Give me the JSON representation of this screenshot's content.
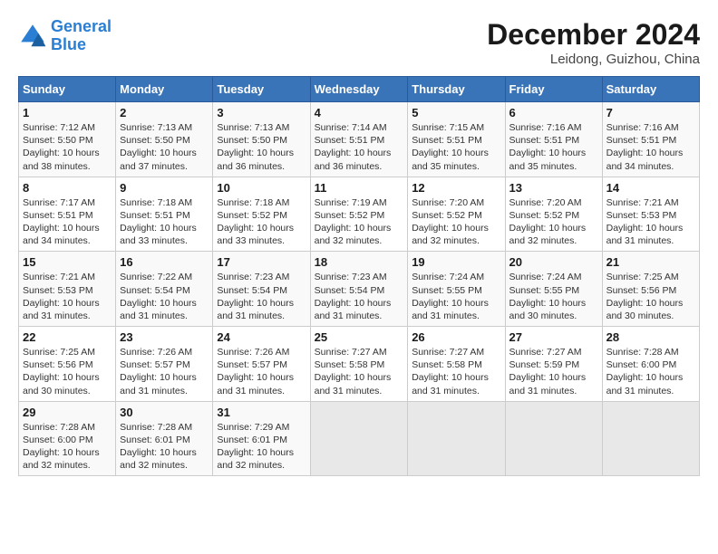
{
  "header": {
    "logo_line1": "General",
    "logo_line2": "Blue",
    "month_year": "December 2024",
    "location": "Leidong, Guizhou, China"
  },
  "weekdays": [
    "Sunday",
    "Monday",
    "Tuesday",
    "Wednesday",
    "Thursday",
    "Friday",
    "Saturday"
  ],
  "weeks": [
    [
      {
        "day": "1",
        "info": "Sunrise: 7:12 AM\nSunset: 5:50 PM\nDaylight: 10 hours\nand 38 minutes."
      },
      {
        "day": "2",
        "info": "Sunrise: 7:13 AM\nSunset: 5:50 PM\nDaylight: 10 hours\nand 37 minutes."
      },
      {
        "day": "3",
        "info": "Sunrise: 7:13 AM\nSunset: 5:50 PM\nDaylight: 10 hours\nand 36 minutes."
      },
      {
        "day": "4",
        "info": "Sunrise: 7:14 AM\nSunset: 5:51 PM\nDaylight: 10 hours\nand 36 minutes."
      },
      {
        "day": "5",
        "info": "Sunrise: 7:15 AM\nSunset: 5:51 PM\nDaylight: 10 hours\nand 35 minutes."
      },
      {
        "day": "6",
        "info": "Sunrise: 7:16 AM\nSunset: 5:51 PM\nDaylight: 10 hours\nand 35 minutes."
      },
      {
        "day": "7",
        "info": "Sunrise: 7:16 AM\nSunset: 5:51 PM\nDaylight: 10 hours\nand 34 minutes."
      }
    ],
    [
      {
        "day": "8",
        "info": "Sunrise: 7:17 AM\nSunset: 5:51 PM\nDaylight: 10 hours\nand 34 minutes."
      },
      {
        "day": "9",
        "info": "Sunrise: 7:18 AM\nSunset: 5:51 PM\nDaylight: 10 hours\nand 33 minutes."
      },
      {
        "day": "10",
        "info": "Sunrise: 7:18 AM\nSunset: 5:52 PM\nDaylight: 10 hours\nand 33 minutes."
      },
      {
        "day": "11",
        "info": "Sunrise: 7:19 AM\nSunset: 5:52 PM\nDaylight: 10 hours\nand 32 minutes."
      },
      {
        "day": "12",
        "info": "Sunrise: 7:20 AM\nSunset: 5:52 PM\nDaylight: 10 hours\nand 32 minutes."
      },
      {
        "day": "13",
        "info": "Sunrise: 7:20 AM\nSunset: 5:52 PM\nDaylight: 10 hours\nand 32 minutes."
      },
      {
        "day": "14",
        "info": "Sunrise: 7:21 AM\nSunset: 5:53 PM\nDaylight: 10 hours\nand 31 minutes."
      }
    ],
    [
      {
        "day": "15",
        "info": "Sunrise: 7:21 AM\nSunset: 5:53 PM\nDaylight: 10 hours\nand 31 minutes."
      },
      {
        "day": "16",
        "info": "Sunrise: 7:22 AM\nSunset: 5:54 PM\nDaylight: 10 hours\nand 31 minutes."
      },
      {
        "day": "17",
        "info": "Sunrise: 7:23 AM\nSunset: 5:54 PM\nDaylight: 10 hours\nand 31 minutes."
      },
      {
        "day": "18",
        "info": "Sunrise: 7:23 AM\nSunset: 5:54 PM\nDaylight: 10 hours\nand 31 minutes."
      },
      {
        "day": "19",
        "info": "Sunrise: 7:24 AM\nSunset: 5:55 PM\nDaylight: 10 hours\nand 31 minutes."
      },
      {
        "day": "20",
        "info": "Sunrise: 7:24 AM\nSunset: 5:55 PM\nDaylight: 10 hours\nand 30 minutes."
      },
      {
        "day": "21",
        "info": "Sunrise: 7:25 AM\nSunset: 5:56 PM\nDaylight: 10 hours\nand 30 minutes."
      }
    ],
    [
      {
        "day": "22",
        "info": "Sunrise: 7:25 AM\nSunset: 5:56 PM\nDaylight: 10 hours\nand 30 minutes."
      },
      {
        "day": "23",
        "info": "Sunrise: 7:26 AM\nSunset: 5:57 PM\nDaylight: 10 hours\nand 31 minutes."
      },
      {
        "day": "24",
        "info": "Sunrise: 7:26 AM\nSunset: 5:57 PM\nDaylight: 10 hours\nand 31 minutes."
      },
      {
        "day": "25",
        "info": "Sunrise: 7:27 AM\nSunset: 5:58 PM\nDaylight: 10 hours\nand 31 minutes."
      },
      {
        "day": "26",
        "info": "Sunrise: 7:27 AM\nSunset: 5:58 PM\nDaylight: 10 hours\nand 31 minutes."
      },
      {
        "day": "27",
        "info": "Sunrise: 7:27 AM\nSunset: 5:59 PM\nDaylight: 10 hours\nand 31 minutes."
      },
      {
        "day": "28",
        "info": "Sunrise: 7:28 AM\nSunset: 6:00 PM\nDaylight: 10 hours\nand 31 minutes."
      }
    ],
    [
      {
        "day": "29",
        "info": "Sunrise: 7:28 AM\nSunset: 6:00 PM\nDaylight: 10 hours\nand 32 minutes."
      },
      {
        "day": "30",
        "info": "Sunrise: 7:28 AM\nSunset: 6:01 PM\nDaylight: 10 hours\nand 32 minutes."
      },
      {
        "day": "31",
        "info": "Sunrise: 7:29 AM\nSunset: 6:01 PM\nDaylight: 10 hours\nand 32 minutes."
      },
      {
        "day": "",
        "info": ""
      },
      {
        "day": "",
        "info": ""
      },
      {
        "day": "",
        "info": ""
      },
      {
        "day": "",
        "info": ""
      }
    ]
  ]
}
